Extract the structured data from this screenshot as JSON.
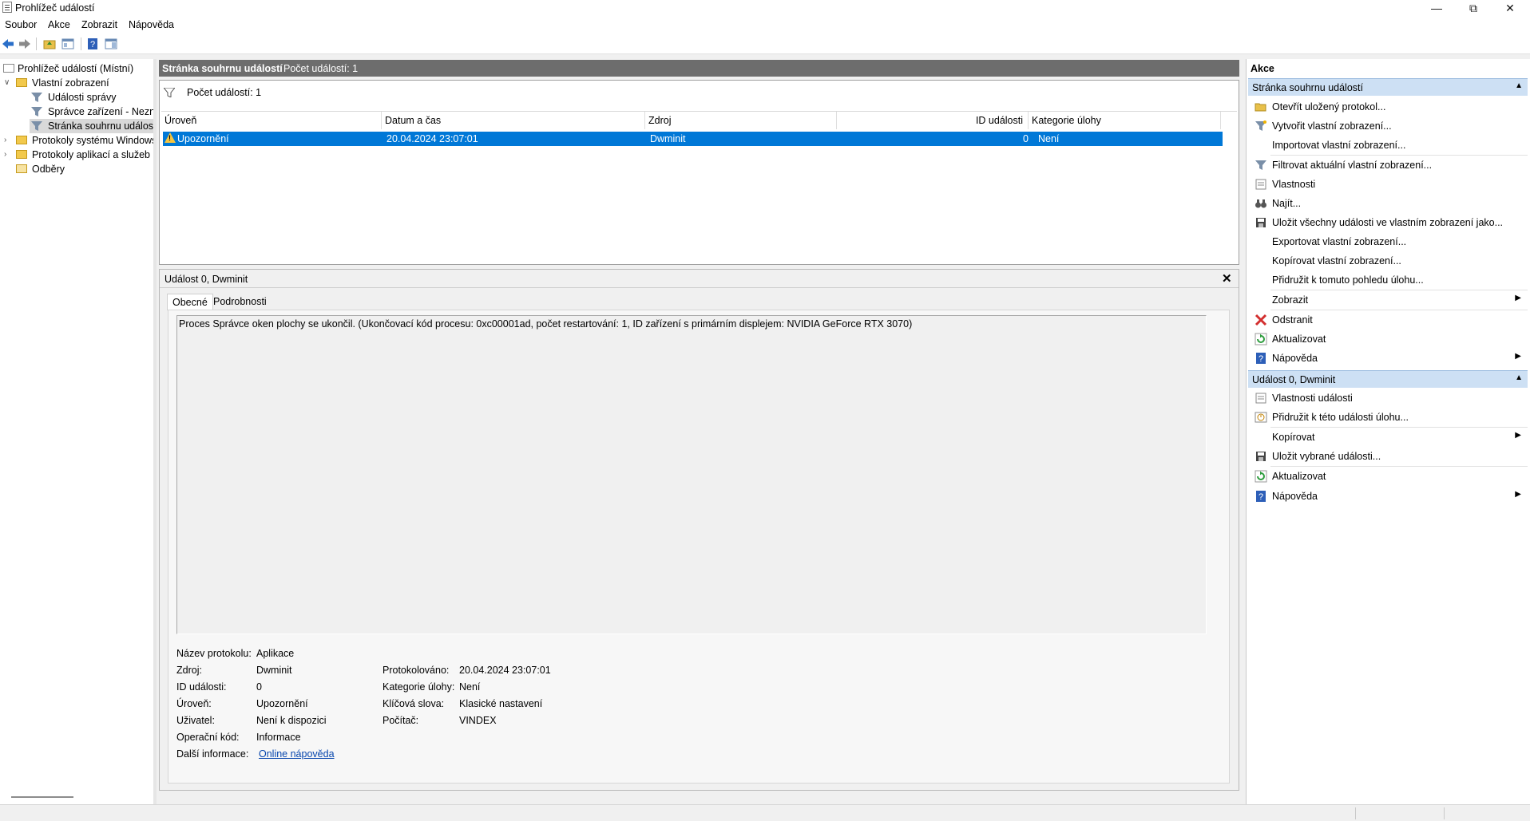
{
  "window": {
    "title": "Prohlížeč událostí"
  },
  "menu": [
    "Soubor",
    "Akce",
    "Zobrazit",
    "Nápověda"
  ],
  "toolbar_icons": [
    "back-icon",
    "forward-icon",
    "up-folder-icon",
    "properties-icon",
    "help-icon",
    "show-hide-icon"
  ],
  "tree": {
    "root": "Prohlížeč událostí (Místní)",
    "custom_views": "Vlastní zobrazení",
    "admin_events": "Události správy",
    "device_manager": "Správce zařízení - Neznár",
    "summary_page": "Stránka souhrnu události",
    "windows_logs": "Protokoly systému Windows",
    "app_logs": "Protokoly aplikací a služeb",
    "subscriptions": "Odběry"
  },
  "center": {
    "header_title": "Stránka souhrnu událostí",
    "header_count": "Počet událostí: 1",
    "filter_text": "Počet událostí: 1",
    "columns": [
      "Úroveň",
      "Datum a čas",
      "Zdroj",
      "ID události",
      "Kategorie úlohy"
    ],
    "row": {
      "level": "Upozornění",
      "datetime": "20.04.2024 23:07:01",
      "source": "Dwminit",
      "event_id": "0",
      "category": "Není"
    }
  },
  "detail": {
    "title": "Událost 0, Dwminit",
    "tabs": [
      "Obecné",
      "Podrobnosti"
    ],
    "description": "Proces Správce oken plochy se ukončil. (Ukončovací kód procesu: 0xc00001ad, počet restartování: 1, ID zařízení s primárním displejem: NVIDIA GeForce RTX 3070)",
    "labels": {
      "log_name": "Název protokolu:",
      "source": "Zdroj:",
      "event_id": "ID události:",
      "level": "Úroveň:",
      "user": "Uživatel:",
      "opcode": "Operační kód:",
      "more_info": "Další informace:",
      "logged": "Protokolováno:",
      "task_category": "Kategorie úlohy:",
      "keywords": "Klíčová slova:",
      "computer": "Počítač:"
    },
    "values": {
      "log_name": "Aplikace",
      "source": "Dwminit",
      "event_id": "0",
      "level": "Upozornění",
      "user": "Není k dispozici",
      "opcode": "Informace",
      "more_info": "Online nápověda",
      "logged": "20.04.2024 23:07:01",
      "task_category": "Není",
      "keywords": "Klasické nastavení",
      "computer": "VINDEX"
    }
  },
  "actions": {
    "title": "Akce",
    "section1_title": "Stránka souhrnu událostí",
    "section1": [
      "Otevřít uložený protokol...",
      "Vytvořit vlastní zobrazení...",
      "Importovat vlastní zobrazení...",
      "Filtrovat aktuální vlastní zobrazení...",
      "Vlastnosti",
      "Najít...",
      "Uložit všechny události ve vlastním zobrazení jako...",
      "Exportovat vlastní zobrazení...",
      "Kopírovat vlastní zobrazení...",
      "Přidružit k tomuto pohledu úlohu...",
      "Zobrazit",
      "Odstranit",
      "Aktualizovat",
      "Nápověda"
    ],
    "section2_title": "Událost 0, Dwminit",
    "section2": [
      "Vlastnosti události",
      "Přidružit k této události úlohu...",
      "Kopírovat",
      "Uložit vybrané události...",
      "Aktualizovat",
      "Nápověda"
    ]
  },
  "colors": {
    "selection": "#0078d7",
    "section_header": "#cde0f4",
    "panel_header": "#6d6d6d"
  }
}
